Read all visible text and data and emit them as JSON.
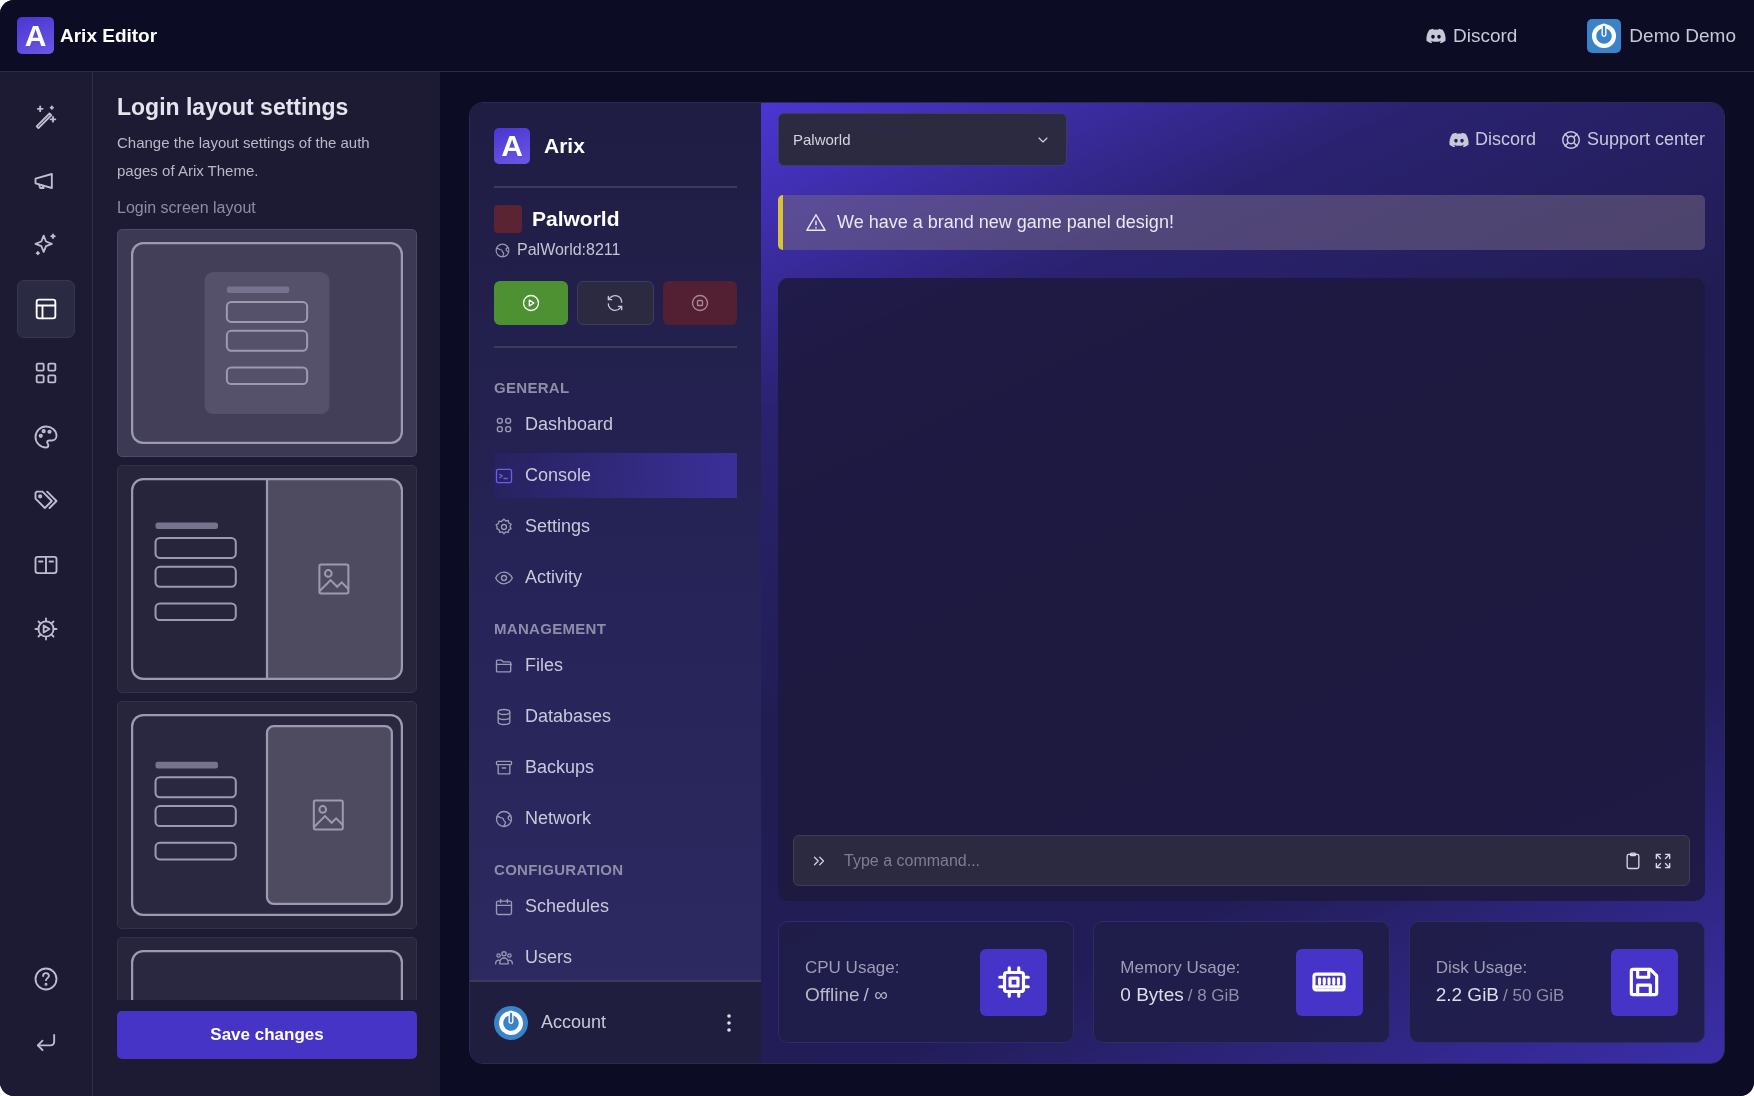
{
  "topbar": {
    "logo_letter": "A",
    "title": "Arix Editor",
    "links": [
      {
        "label": "Discord"
      }
    ],
    "user": {
      "name": "Demo Demo"
    }
  },
  "rail": {
    "items": [
      {
        "selected": false
      },
      {
        "selected": false
      },
      {
        "selected": false
      },
      {
        "selected": true
      },
      {
        "selected": false
      },
      {
        "selected": false
      },
      {
        "selected": false
      },
      {
        "selected": false
      },
      {
        "selected": false
      }
    ],
    "bottom_items": [
      {
        "kind": "help"
      },
      {
        "kind": "exit"
      }
    ]
  },
  "settings": {
    "title": "Login layout settings",
    "description": "Change the layout settings of the auth pages of Arix Theme.",
    "section_label": "Login screen layout",
    "layouts": [
      {
        "kind": "centered",
        "selected": true
      },
      {
        "kind": "split",
        "selected": false
      },
      {
        "kind": "split-inset",
        "selected": false
      },
      {
        "kind": "stacked",
        "selected": false
      }
    ],
    "save_label": "Save changes"
  },
  "preview": {
    "brand": {
      "logo_letter": "A",
      "name": "Arix"
    },
    "server": {
      "name": "Palworld",
      "address": "PalWorld:8211"
    },
    "power_buttons": [
      {
        "kind": "start"
      },
      {
        "kind": "restart"
      },
      {
        "kind": "stop"
      }
    ],
    "nav_sections": [
      {
        "title": "GENERAL",
        "items": [
          {
            "label": "Dashboard",
            "selected": false
          },
          {
            "label": "Console",
            "selected": true
          },
          {
            "label": "Settings",
            "selected": false
          },
          {
            "label": "Activity",
            "selected": false
          }
        ]
      },
      {
        "title": "MANAGEMENT",
        "items": [
          {
            "label": "Files",
            "selected": false
          },
          {
            "label": "Databases",
            "selected": false
          },
          {
            "label": "Backups",
            "selected": false
          },
          {
            "label": "Network",
            "selected": false
          }
        ]
      },
      {
        "title": "CONFIGURATION",
        "items": [
          {
            "label": "Schedules",
            "selected": false
          },
          {
            "label": "Users",
            "selected": false
          }
        ]
      }
    ],
    "account": {
      "label": "Account"
    },
    "server_select": {
      "value": "Palworld"
    },
    "links": [
      {
        "kind": "discord",
        "label": "Discord"
      },
      {
        "kind": "support",
        "label": "Support center"
      }
    ],
    "alert": {
      "text": "We have a brand new game panel design!"
    },
    "console": {
      "placeholder": "Type a command..."
    },
    "stats": [
      {
        "kind": "cpu",
        "label": "CPU Usage:",
        "value": "Offline",
        "limit": "/ ∞"
      },
      {
        "kind": "memory",
        "label": "Memory Usage:",
        "value": "0 Bytes",
        "limit": "/ 8 GiB"
      },
      {
        "kind": "disk",
        "label": "Disk Usage:",
        "value": "2.2 GiB",
        "limit": "/ 50 GiB"
      }
    ]
  }
}
